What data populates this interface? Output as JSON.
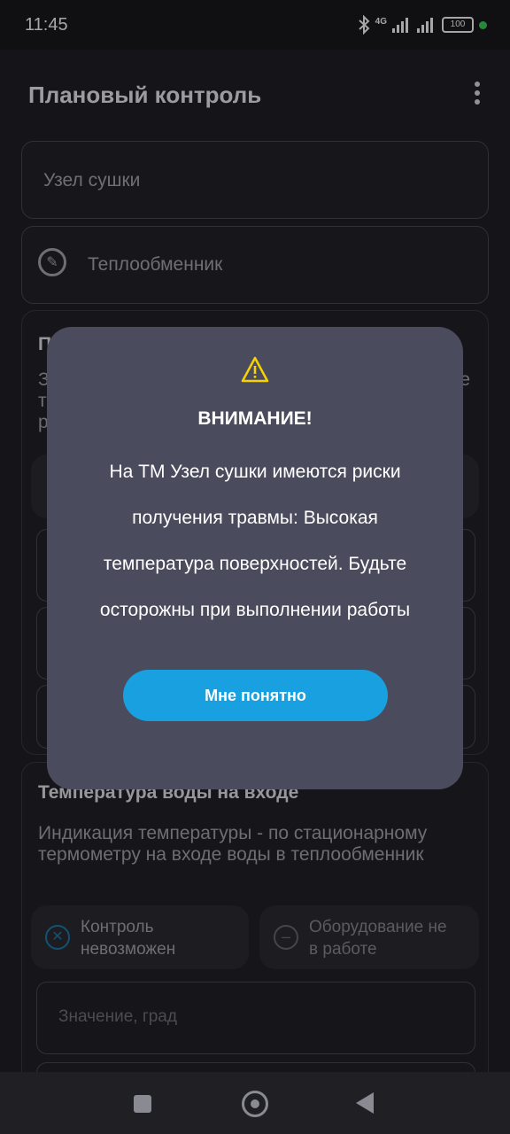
{
  "status": {
    "time": "11:45",
    "network": "4G",
    "battery": "100"
  },
  "app": {
    "title": "Плановый контроль"
  },
  "fields": {
    "node": "Узел сушки",
    "equipment": "Теплообменник"
  },
  "card_hidden": {
    "title_partial": "П",
    "desc_left": [
      "З",
      "т",
      "р"
    ],
    "desc_right": "е"
  },
  "card_water": {
    "title": "Температура воды на входе",
    "description": "Индикация температуры - по стационарному термометру на входе воды в теплообменник",
    "chip_impossible": {
      "line1": "Контроль",
      "line2": "невозможен"
    },
    "chip_not_working": {
      "line1": "Оборудование не",
      "line2": "в работе"
    },
    "input_placeholder": "Значение, град"
  },
  "dialog": {
    "title": "ВНИМАНИЕ!",
    "lines": [
      "На ТМ Узел сушки имеются риски",
      "получения травмы: Высокая",
      "температура поверхностей. Будьте",
      "осторожны при выполнении работы"
    ],
    "button": "Мне понятно",
    "accent_color": "#18a0e0",
    "warning_color": "#f5d300"
  }
}
